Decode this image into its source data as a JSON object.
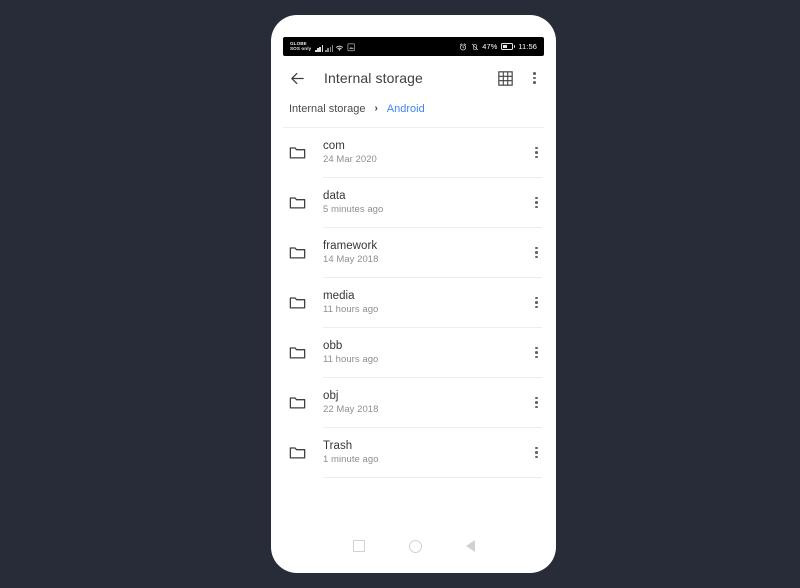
{
  "statusbar": {
    "carrier_line1": "GLOBE",
    "carrier_line2": "SOS only",
    "signal_icon": "signal-bars-icon",
    "signal_icon_2": "signal-bars-secondary-icon",
    "wifi_icon": "wifi-icon",
    "screenshot_icon": "screenshot-icon",
    "alarm_icon": "alarm-icon",
    "vibrate_icon": "vibrate-off-icon",
    "battery_percent": "47%",
    "battery_icon": "battery-icon",
    "clock": "11:56"
  },
  "appbar": {
    "back_icon": "back-arrow-icon",
    "title": "Internal storage",
    "grid_icon": "grid-view-icon",
    "overflow_icon": "more-vertical-icon"
  },
  "breadcrumb": {
    "root": "Internal storage",
    "separator": "›",
    "current": "Android",
    "link_color": "#4285f4"
  },
  "files": [
    {
      "icon": "folder-icon",
      "name": "com",
      "modified": "24 Mar 2020",
      "menu_icon": "more-vertical-icon"
    },
    {
      "icon": "folder-icon",
      "name": "data",
      "modified": "5 minutes ago",
      "menu_icon": "more-vertical-icon"
    },
    {
      "icon": "folder-icon",
      "name": "framework",
      "modified": "14 May 2018",
      "menu_icon": "more-vertical-icon"
    },
    {
      "icon": "folder-icon",
      "name": "media",
      "modified": "11 hours ago",
      "menu_icon": "more-vertical-icon"
    },
    {
      "icon": "folder-icon",
      "name": "obb",
      "modified": "11 hours ago",
      "menu_icon": "more-vertical-icon"
    },
    {
      "icon": "folder-icon",
      "name": "obj",
      "modified": "22 May 2018",
      "menu_icon": "more-vertical-icon"
    },
    {
      "icon": "folder-icon",
      "name": "Trash",
      "modified": "1 minute ago",
      "menu_icon": "more-vertical-icon"
    }
  ],
  "navbar": {
    "recents_icon": "recents-square-icon",
    "home_icon": "home-circle-icon",
    "back_icon": "back-triangle-icon"
  },
  "theme": {
    "page_background": "#282b38",
    "phone_background": "#ffffff",
    "statusbar_background": "#000000"
  }
}
